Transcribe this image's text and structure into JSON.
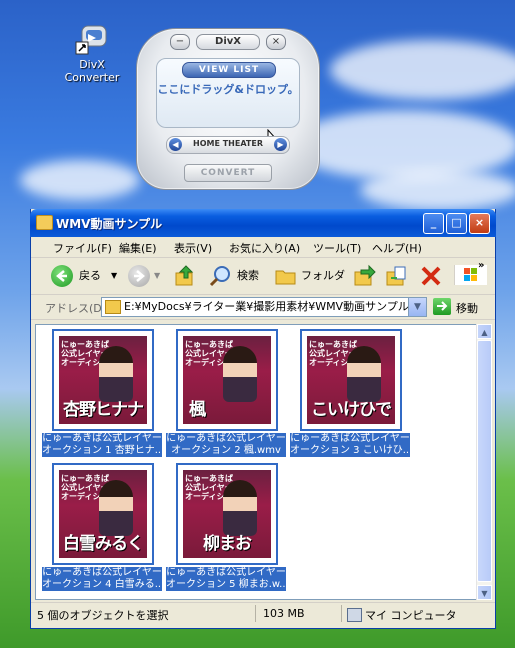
{
  "desktop": {
    "icon_label": "DivX Converter"
  },
  "divx": {
    "logo": "DivX",
    "minimize": "−",
    "close": "×",
    "view_list": "VIEW LIST",
    "drop_text": "ここにドラッグ&ドロップ。",
    "home_theater": "HOME THEATER",
    "prev": "◀",
    "next": "▶",
    "convert": "CONVERT"
  },
  "window": {
    "title": "WMV動画サンプル",
    "controls": {
      "minimize": "_",
      "maximize": "□",
      "close": "×"
    },
    "menu": [
      "ファイル(F)",
      "編集(E)",
      "表示(V)",
      "お気に入り(A)",
      "ツール(T)",
      "ヘルプ(H)"
    ],
    "toolbar": {
      "back": "戻る",
      "search": "検索",
      "folder": "フォルダ"
    },
    "address": {
      "label": "アドレス(D)",
      "value": "E:¥MyDocs¥ライター業¥撮影用素材¥WMV動画サンプル",
      "go": "移動"
    },
    "files": [
      {
        "thumb_name": "杏野ヒナナ",
        "caption1": "にゅーあきば公式レイヤー",
        "caption2": "オークション 1 杏野ヒナ..."
      },
      {
        "thumb_name": "楓",
        "caption1": "にゅーあきば公式レイヤー",
        "caption2": "オークション 2 楓.wmv"
      },
      {
        "thumb_name": "こいけひで",
        "caption1": "にゅーあきば公式レイヤー",
        "caption2": "オークション 3 こいけひ..."
      },
      {
        "thumb_name": "白雪みるく",
        "caption1": "にゅーあきば公式レイヤー",
        "caption2": "オークション 4 白雪みる..."
      },
      {
        "thumb_name": "柳まお",
        "caption1": "にゅーあきば公式レイヤー",
        "caption2": "オークション 5 柳まお.w..."
      }
    ],
    "thumb_header": "にゅーあきば\n公式レイヤー\nオーディション",
    "status": {
      "selection": "5 個のオブジェクトを選択",
      "size": "103 MB",
      "location": "マイ コンピュータ"
    }
  }
}
